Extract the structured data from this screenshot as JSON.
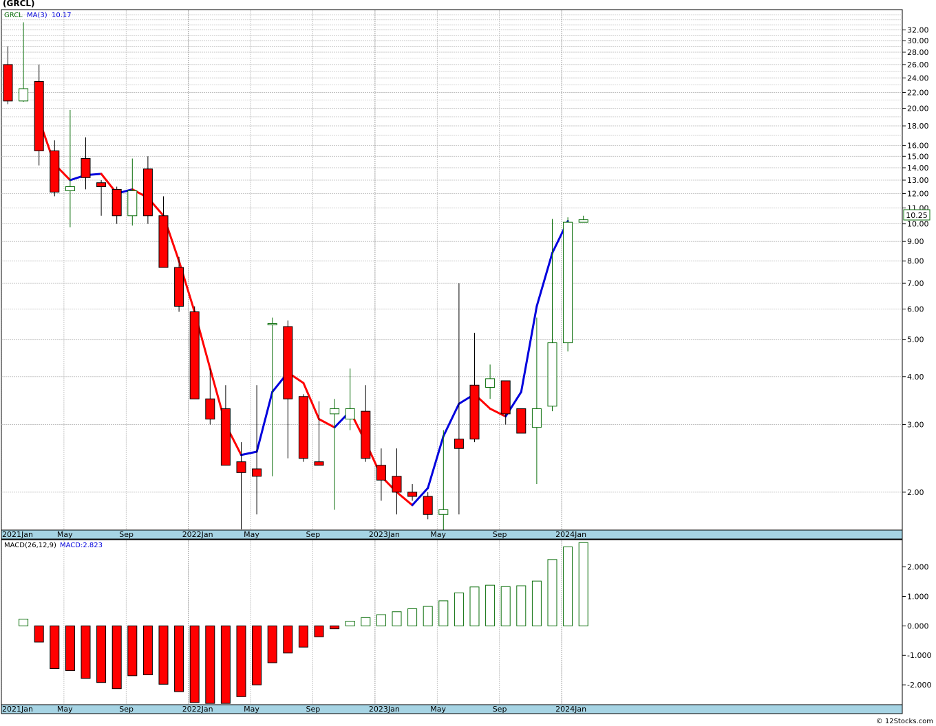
{
  "title": "(GRCL)",
  "credit": "© 12Stocks.com",
  "colors": {
    "up": "#0a6e0a",
    "down": "#ff0000",
    "ma_up": "#0000dd",
    "ma_down": "#ff0000",
    "axis_band": "#a6d4e4",
    "grid": "#bbbbbb"
  },
  "legend": {
    "symbol": "GRCL",
    "ma_label": "MA(3)",
    "ma_value": "10.17",
    "macd_label": "MACD(26,12,9)",
    "macd_value": "MACD:2.823"
  },
  "last_price_label": "10.25",
  "x_labels": [
    "2021Jan",
    "May",
    "Sep",
    "2022Jan",
    "May",
    "Sep",
    "2023Jan",
    "May",
    "Sep",
    "2024Jan"
  ],
  "chart_data": [
    {
      "type": "candlestick",
      "title": "(GRCL)",
      "y_scale": "log",
      "ylim": [
        1.6,
        36
      ],
      "y_ticks": [
        "32.00",
        "30.00",
        "28.00",
        "26.00",
        "24.00",
        "22.00",
        "20.00",
        "18.00",
        "16.00",
        "15.00",
        "14.00",
        "13.00",
        "12.00",
        "11.00",
        "10.00",
        "9.00",
        "8.00",
        "7.00",
        "6.00",
        "5.00",
        "4.00",
        "3.00",
        "2.00"
      ],
      "grid": true,
      "period": "monthly",
      "months": [
        "2021-01",
        "2021-02",
        "2021-03",
        "2021-04",
        "2021-05",
        "2021-06",
        "2021-07",
        "2021-08",
        "2021-09",
        "2021-10",
        "2021-11",
        "2021-12",
        "2022-01",
        "2022-02",
        "2022-03",
        "2022-04",
        "2022-05",
        "2022-06",
        "2022-07",
        "2022-08",
        "2022-09",
        "2022-10",
        "2022-11",
        "2022-12",
        "2023-01",
        "2023-02",
        "2023-03",
        "2023-04",
        "2023-05",
        "2023-06",
        "2023-07",
        "2023-08",
        "2023-09",
        "2023-10",
        "2023-11",
        "2023-12",
        "2024-01",
        "2024-02"
      ],
      "open": [
        26.0,
        20.9,
        23.5,
        15.5,
        12.2,
        14.8,
        12.8,
        12.3,
        10.5,
        13.9,
        10.5,
        7.7,
        5.9,
        3.5,
        3.3,
        2.4,
        2.3,
        5.5,
        5.4,
        3.55,
        2.4,
        3.2,
        3.1,
        3.25,
        2.35,
        2.2,
        2.0,
        1.95,
        1.75,
        2.75,
        3.8,
        3.75,
        3.9,
        3.3,
        2.95,
        3.35,
        4.9,
        10.1
      ],
      "high": [
        29.0,
        33.5,
        26.0,
        16.5,
        19.8,
        16.8,
        13.0,
        12.5,
        14.8,
        15.0,
        11.8,
        8.2,
        6.1,
        4.2,
        3.8,
        2.7,
        3.8,
        5.7,
        5.6,
        3.6,
        3.45,
        3.5,
        4.2,
        3.8,
        2.6,
        2.6,
        2.1,
        2.0,
        2.9,
        7.0,
        5.2,
        4.3,
        3.85,
        3.25,
        5.7,
        10.3,
        10.4,
        10.5
      ],
      "low": [
        20.5,
        20.8,
        14.2,
        11.8,
        9.8,
        12.3,
        10.5,
        10.0,
        9.9,
        10.0,
        9.8,
        5.9,
        5.6,
        3.0,
        2.6,
        1.6,
        1.75,
        2.2,
        2.45,
        2.4,
        2.4,
        1.8,
        2.9,
        2.4,
        1.9,
        1.75,
        1.9,
        1.7,
        1.5,
        1.75,
        2.7,
        3.5,
        3.0,
        2.9,
        2.1,
        3.25,
        4.65,
        10.1
      ],
      "close": [
        20.9,
        22.5,
        15.5,
        12.1,
        12.5,
        13.2,
        12.5,
        10.5,
        12.2,
        10.5,
        7.7,
        6.1,
        3.5,
        3.1,
        2.35,
        2.25,
        2.2,
        5.5,
        3.5,
        2.45,
        2.35,
        3.3,
        3.3,
        2.45,
        2.15,
        2.0,
        1.95,
        1.75,
        1.8,
        2.6,
        2.75,
        3.95,
        3.2,
        2.85,
        3.3,
        4.9,
        10.1,
        10.25
      ]
    },
    {
      "type": "line",
      "name": "MA(3)",
      "months_from_index": 2,
      "values": [
        18.7,
        14.3,
        13.0,
        13.4,
        13.5,
        12.0,
        12.3,
        11.7,
        10.5,
        8.0,
        5.9,
        4.2,
        3.0,
        2.5,
        2.55,
        3.65,
        4.1,
        3.85,
        3.1,
        2.95,
        3.25,
        2.7,
        2.2,
        2.0,
        1.85,
        2.05,
        2.8,
        3.4,
        3.6,
        3.3,
        3.15,
        3.65,
        6.1,
        8.4,
        10.17
      ]
    },
    {
      "type": "bar",
      "name": "MACD(26,12,9)",
      "ylim": [
        -2.65,
        2.9
      ],
      "y_ticks": [
        "2.000",
        "1.000",
        "0.000",
        "-1.000",
        "-2.000"
      ],
      "values": [
        0.23,
        -0.55,
        -1.45,
        -1.52,
        -1.78,
        -1.92,
        -2.13,
        -1.69,
        -1.66,
        -1.98,
        -2.23,
        -2.6,
        -2.63,
        -2.63,
        -2.4,
        -2.0,
        -1.25,
        -0.92,
        -0.72,
        -0.37,
        -0.1,
        0.16,
        0.28,
        0.38,
        0.48,
        0.58,
        0.66,
        0.85,
        1.12,
        1.32,
        1.38,
        1.33,
        1.36,
        1.52,
        2.25,
        2.68,
        2.823
      ]
    }
  ]
}
